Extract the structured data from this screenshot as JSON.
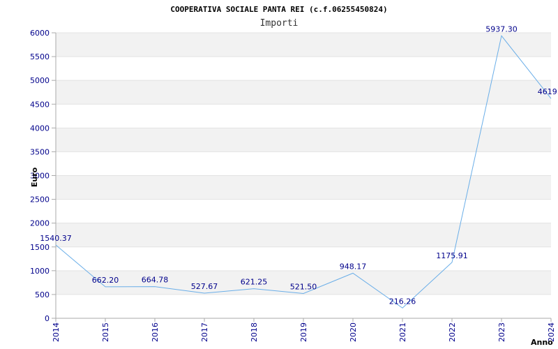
{
  "chart_data": {
    "type": "line",
    "title": "COOPERATIVA SOCIALE PANTA REI (c.f.06255450824)",
    "subtitle": "Importi",
    "ylabel": "Euro",
    "xlabel": "Anno",
    "x": [
      "2014",
      "2015",
      "2016",
      "2017",
      "2018",
      "2019",
      "2020",
      "2021",
      "2022",
      "2023",
      "2024"
    ],
    "series": [
      {
        "values": [
          1540.37,
          662.2,
          664.78,
          527.67,
          621.25,
          521.5,
          948.17,
          216.26,
          1175.91,
          5937.3,
          4619.0
        ],
        "labels": [
          "1540.37",
          "662.20",
          "664.78",
          "527.67",
          "621.25",
          "521.50",
          "948.17",
          "216.26",
          "1175.91",
          "5937.30",
          "4619.0"
        ]
      }
    ],
    "ylim": [
      0,
      6000
    ],
    "yticks": [
      "0",
      "500",
      "1000",
      "1500",
      "2000",
      "2500",
      "3000",
      "3500",
      "4000",
      "4500",
      "5000",
      "5500",
      "6000"
    ],
    "grid": true,
    "colors": {
      "line": "#6aaee8",
      "band": "#f2f2f2",
      "tick_text": "#00008b",
      "axis": "#aaaaaa"
    }
  }
}
